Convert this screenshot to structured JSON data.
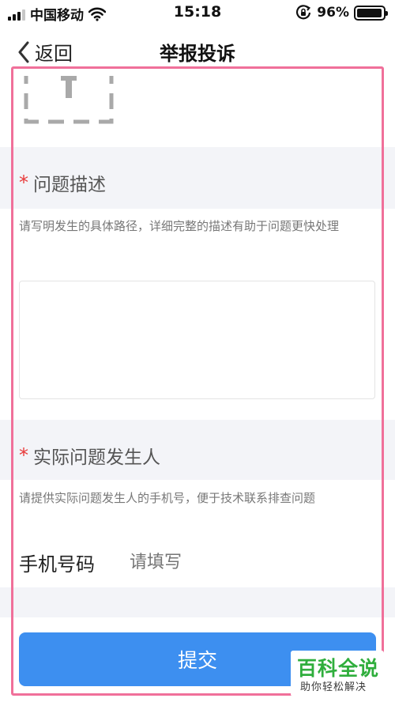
{
  "status_bar": {
    "carrier": "中国移动",
    "time": "15:18",
    "battery_percent": "96%",
    "battery_level": 0.96,
    "icons": [
      "signal-icon",
      "wifi-icon",
      "rotation-lock-icon",
      "battery-icon"
    ]
  },
  "nav": {
    "back_label": "返回",
    "title": "举报投诉"
  },
  "problem_section": {
    "required_mark": "*",
    "title": "问题描述",
    "hint": "请写明发生的具体路径，详细完整的描述有助于问题更快处理",
    "textarea_value": ""
  },
  "person_section": {
    "required_mark": "*",
    "title": "实际问题发生人",
    "hint": "请提供实际问题发生人的手机号，便于技术联系排查问题",
    "phone_label": "手机号码",
    "phone_placeholder": "请填写"
  },
  "submit_label": "提交",
  "watermark": {
    "title": "百科全说",
    "subtitle": "助你轻松解决"
  },
  "colors": {
    "accent": "#3d8ff0",
    "required": "#e83a3a",
    "highlight_frame": "#f0709a",
    "section_bg": "#f3f4f8",
    "watermark_green": "#2fae3c"
  }
}
